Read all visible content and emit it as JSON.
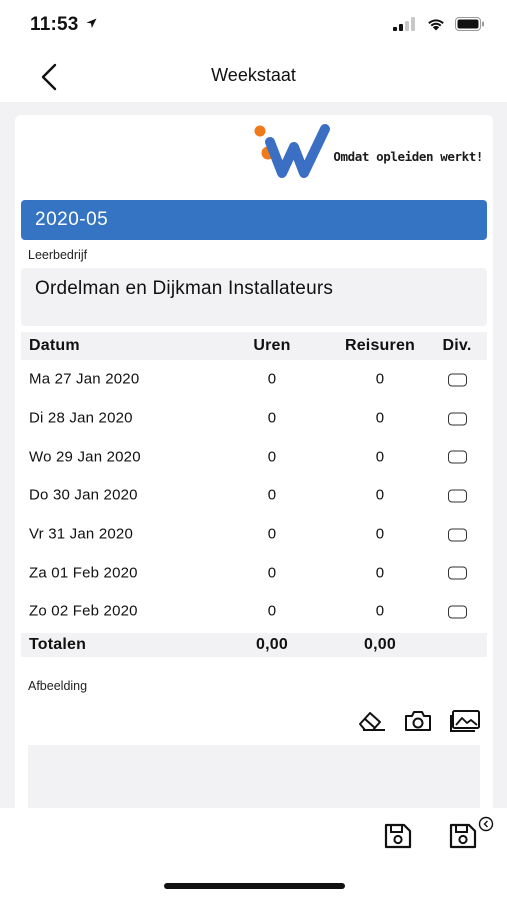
{
  "status_bar": {
    "time": "11:53",
    "icons": [
      "location-arrow-icon",
      "cellular-signal-icon",
      "wifi-icon",
      "battery-icon"
    ]
  },
  "nav": {
    "title": "Weekstaat",
    "back_icon": "chevron-left-icon"
  },
  "logo": {
    "tagline": "Omdat opleiden werkt!",
    "colors": {
      "orange": "#f07a1a",
      "blue": "#3a6fc4"
    }
  },
  "week": {
    "label": "2020-05",
    "color": "#3574c2"
  },
  "company": {
    "label": "Leerbedrijf",
    "value": "Ordelman en Dijkman Installateurs"
  },
  "table": {
    "headers": {
      "date": "Datum",
      "uren": "Uren",
      "reisuren": "Reisuren",
      "div": "Div."
    },
    "rows": [
      {
        "date": "Ma 27 Jan 2020",
        "uren": "0",
        "reisuren": "0"
      },
      {
        "date": "Di 28 Jan 2020",
        "uren": "0",
        "reisuren": "0"
      },
      {
        "date": "Wo 29 Jan 2020",
        "uren": "0",
        "reisuren": "0"
      },
      {
        "date": "Do 30 Jan 2020",
        "uren": "0",
        "reisuren": "0"
      },
      {
        "date": "Vr 31 Jan 2020",
        "uren": "0",
        "reisuren": "0"
      },
      {
        "date": "Za 01 Feb 2020",
        "uren": "0",
        "reisuren": "0"
      },
      {
        "date": "Zo 02 Feb 2020",
        "uren": "0",
        "reisuren": "0"
      }
    ],
    "totals": {
      "label": "Totalen",
      "uren": "0,00",
      "reisuren": "0,00"
    }
  },
  "image_section": {
    "label": "Afbeelding",
    "actions": [
      "eraser-icon",
      "camera-icon",
      "image-gallery-icon"
    ]
  },
  "bottom_bar": {
    "actions": [
      "save-icon",
      "save-and-close-icon"
    ]
  }
}
